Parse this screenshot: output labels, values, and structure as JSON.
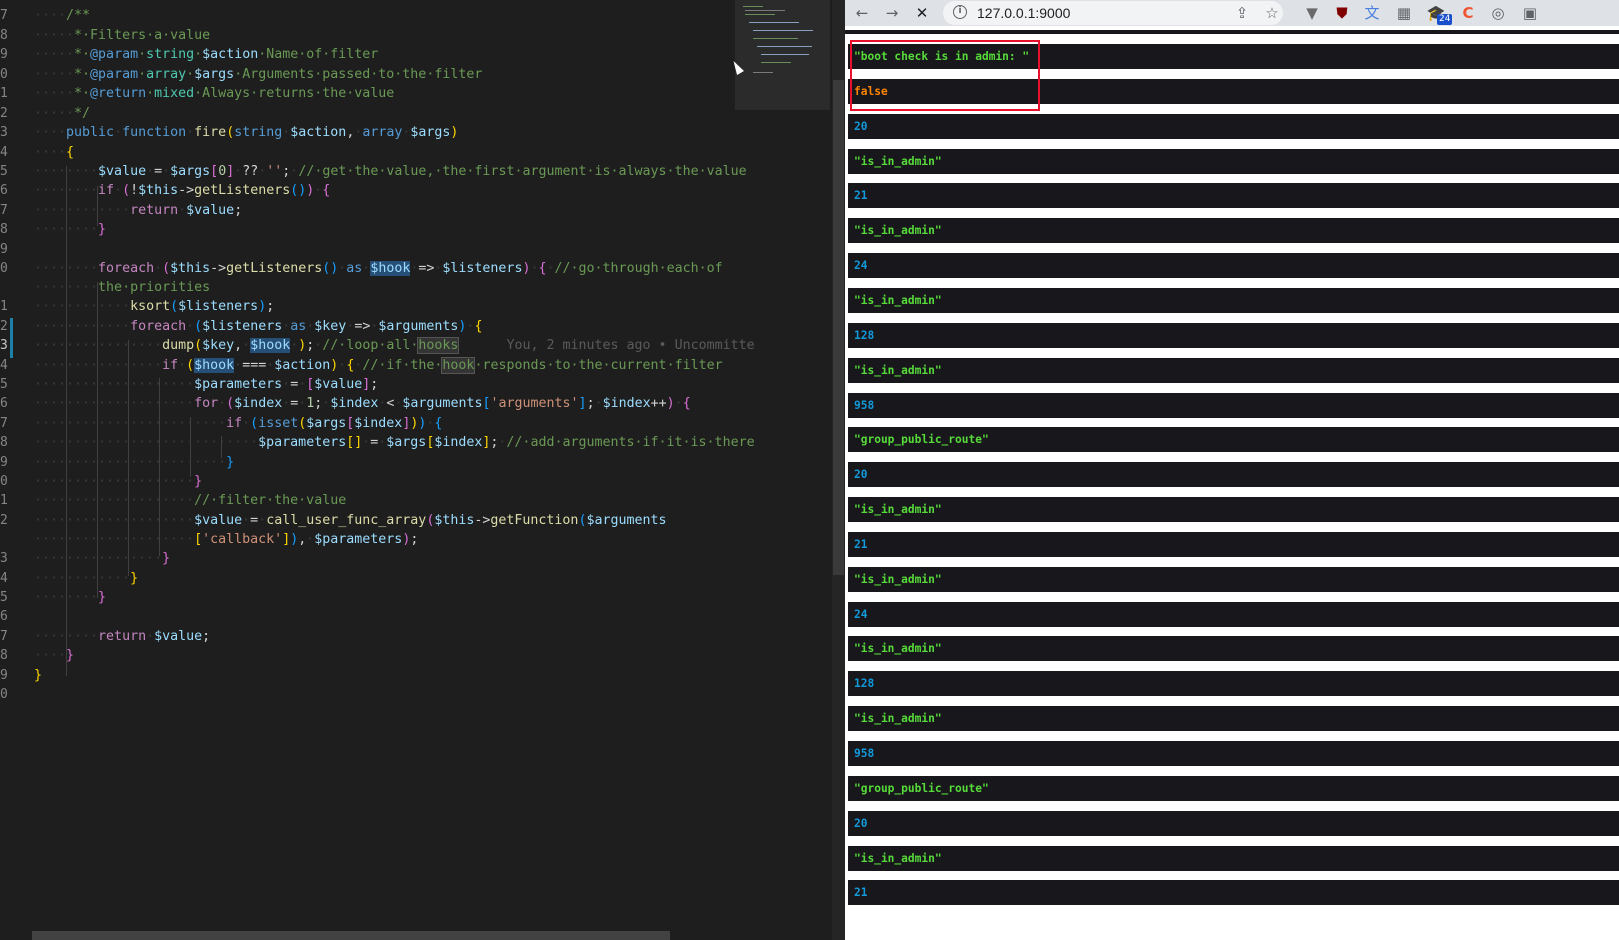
{
  "editor": {
    "line_numbers": [
      "7",
      "8",
      "9",
      "0",
      "1",
      "2",
      "3",
      "4",
      "5",
      "6",
      "7",
      "8",
      "9",
      "0",
      "",
      "1",
      "2",
      "3",
      "4",
      "5",
      "6",
      "7",
      "8",
      "9",
      "0",
      "1",
      "2",
      "",
      "3",
      "4",
      "5",
      "6",
      "7",
      "8",
      "9",
      "0"
    ],
    "blame": "You, 2 minutes ago • Uncommitte"
  },
  "browser": {
    "url": "127.0.0.1:9000",
    "extension_badge": "24",
    "icons": [
      "back-icon",
      "forward-icon",
      "stop-icon",
      "share-icon",
      "star-icon",
      "vuetify-icon",
      "ublock-icon",
      "translate-icon",
      "qr-icon",
      "extension-icon",
      "colorzilla-icon",
      "circle-icon",
      "pip-icon"
    ]
  },
  "dumps": [
    {
      "text": "\"boot check is in admin: \"",
      "kind": "str"
    },
    {
      "text": "false",
      "kind": "bool"
    },
    {
      "text": "20",
      "kind": "int"
    },
    {
      "text": "\"is_in_admin\"",
      "kind": "str"
    },
    {
      "text": "21",
      "kind": "int"
    },
    {
      "text": "\"is_in_admin\"",
      "kind": "str"
    },
    {
      "text": "24",
      "kind": "int"
    },
    {
      "text": "\"is_in_admin\"",
      "kind": "str"
    },
    {
      "text": "128",
      "kind": "int"
    },
    {
      "text": "\"is_in_admin\"",
      "kind": "str"
    },
    {
      "text": "958",
      "kind": "int"
    },
    {
      "text": "\"group_public_route\"",
      "kind": "str"
    },
    {
      "text": "20",
      "kind": "int"
    },
    {
      "text": "\"is_in_admin\"",
      "kind": "str"
    },
    {
      "text": "21",
      "kind": "int"
    },
    {
      "text": "\"is_in_admin\"",
      "kind": "str"
    },
    {
      "text": "24",
      "kind": "int"
    },
    {
      "text": "\"is_in_admin\"",
      "kind": "str"
    },
    {
      "text": "128",
      "kind": "int"
    },
    {
      "text": "\"is_in_admin\"",
      "kind": "str"
    },
    {
      "text": "958",
      "kind": "int"
    },
    {
      "text": "\"group_public_route\"",
      "kind": "str"
    },
    {
      "text": "20",
      "kind": "int"
    },
    {
      "text": "\"is_in_admin\"",
      "kind": "str"
    },
    {
      "text": "21",
      "kind": "int"
    }
  ],
  "colors": {
    "string_dump": "#56db3a",
    "int_dump": "#1299da",
    "bool_dump": "#ff8400",
    "highlight_box": "#e8102c"
  }
}
